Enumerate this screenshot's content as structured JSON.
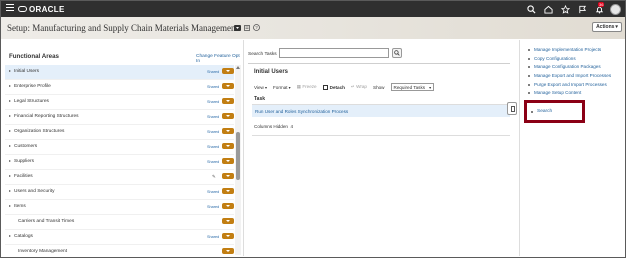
{
  "header": {
    "brand": "ORACLE",
    "notification_count": "36",
    "actions_label": "Actions"
  },
  "page": {
    "title": "Setup: Manufacturing and Supply Chain Materials Management"
  },
  "functional_areas": {
    "title": "Functional Areas",
    "change_link": "Change Feature Opt In",
    "items": [
      {
        "label": "Initial Users",
        "status": "Shared",
        "expandable": true,
        "selected": true
      },
      {
        "label": "Enterprise Profile",
        "status": "Shared",
        "expandable": true
      },
      {
        "label": "Legal Structures",
        "status": "Shared",
        "expandable": true
      },
      {
        "label": "Financial Reporting Structures",
        "status": "Shared",
        "expandable": true
      },
      {
        "label": "Organization Structures",
        "status": "Shared",
        "expandable": true
      },
      {
        "label": "Customers",
        "status": "Shared",
        "expandable": true
      },
      {
        "label": "Suppliers",
        "status": "Shared",
        "expandable": true
      },
      {
        "label": "Facilities",
        "status": "",
        "expandable": true
      },
      {
        "label": "Users and Security",
        "status": "Shared",
        "expandable": true
      },
      {
        "label": "Items",
        "status": "Shared",
        "expandable": true
      },
      {
        "label": "Carriers and Transit Times",
        "status": "",
        "expandable": false
      },
      {
        "label": "Catalogs",
        "status": "Shared",
        "expandable": true
      },
      {
        "label": "Inventory Management",
        "status": "",
        "expandable": false
      }
    ]
  },
  "search": {
    "label": "Search Tasks",
    "value": ""
  },
  "initial_users": {
    "title": "Initial Users",
    "toolbar": {
      "view": "View",
      "format": "Format",
      "freeze": "Freeze",
      "detach": "Detach",
      "wrap": "Wrap",
      "show_label": "Show",
      "show_value": "Required Tasks"
    },
    "task_header": "Task",
    "tasks": [
      {
        "label": "Run User and Roles Synchronization Process"
      }
    ],
    "columns_hidden_label": "Columns Hidden",
    "columns_hidden_count": "4"
  },
  "tasks_panel": {
    "links": [
      "Manage Implementation Projects",
      "Copy Configurations",
      "Manage Configuration Packages",
      "Manage Export and Import Processes",
      "Purge Export and Import Processes",
      "Manage Setup Content"
    ],
    "search_link": "Search"
  },
  "colors": {
    "topbar": "#2f2f2f",
    "link": "#1f5f9a",
    "chevron_button": "#c27e12",
    "highlight_box": "#8b0015",
    "selected_row": "#e4effa"
  }
}
